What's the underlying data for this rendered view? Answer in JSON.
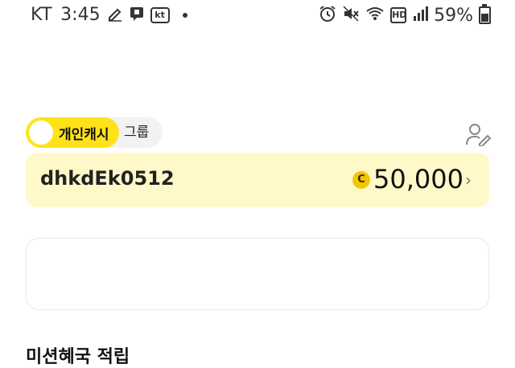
{
  "status_bar": {
    "carrier": "KT",
    "time": "3:45",
    "kt_badge": "kt",
    "battery": "59%",
    "network": "HD",
    "icons": [
      "pencil-icon",
      "chat-icon",
      "kt-icon",
      "alarm-icon",
      "mute-icon",
      "wifi-icon",
      "hd-icon",
      "signal-icon",
      "battery-icon"
    ]
  },
  "toggle": {
    "active_label": "개인캐시",
    "other_label": "그룹"
  },
  "cash_card": {
    "username": "dhkdEk0512",
    "coin_symbol": "C",
    "amount": "50,000",
    "chevron": "›"
  },
  "section": {
    "title": "미션혜국 적립"
  },
  "colors": {
    "accent_yellow": "#ffe21a",
    "card_bg": "#fff8c9",
    "coin": "#f2c600"
  }
}
